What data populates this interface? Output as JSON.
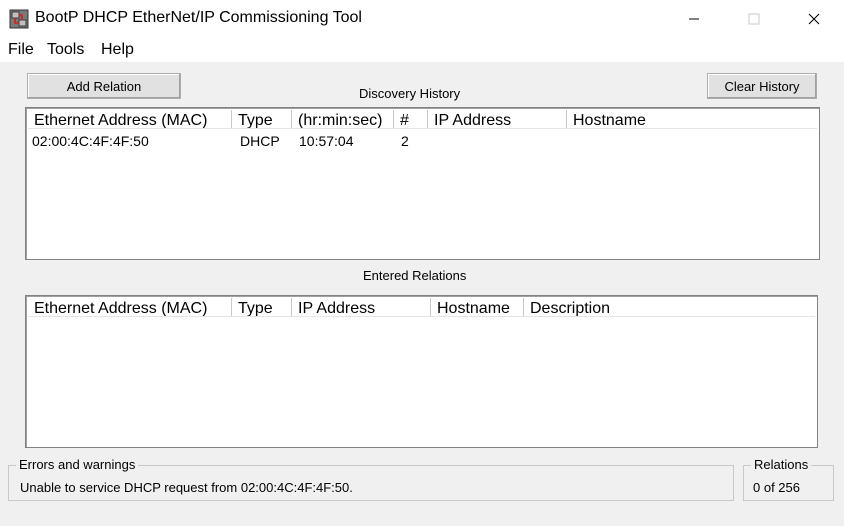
{
  "window": {
    "title": "BootP DHCP EtherNet/IP Commissioning Tool",
    "controls": {
      "minimize": "—",
      "maximize": "☐",
      "close": "✕"
    }
  },
  "menu": {
    "items": [
      "File",
      "Tools",
      "Help"
    ]
  },
  "toolbar": {
    "add_relation_label": "Add Relation",
    "clear_history_label": "Clear History"
  },
  "discovery": {
    "title": "Discovery History",
    "columns": [
      "Ethernet Address (MAC)",
      "Type",
      "(hr:min:sec)",
      "#",
      "IP Address",
      "Hostname"
    ],
    "rows": [
      [
        "02:00:4C:4F:4F:50",
        "DHCP",
        "10:57:04",
        "2",
        "",
        ""
      ]
    ]
  },
  "relations": {
    "title": "Entered Relations",
    "columns": [
      "Ethernet Address (MAC)",
      "Type",
      "IP Address",
      "Hostname",
      "Description"
    ],
    "rows": []
  },
  "status": {
    "errors_label": "Errors and warnings",
    "errors_message": "Unable to service DHCP request from 02:00:4C:4F:4F:50.",
    "relations_label": "Relations",
    "relations_count": "0 of 256"
  }
}
